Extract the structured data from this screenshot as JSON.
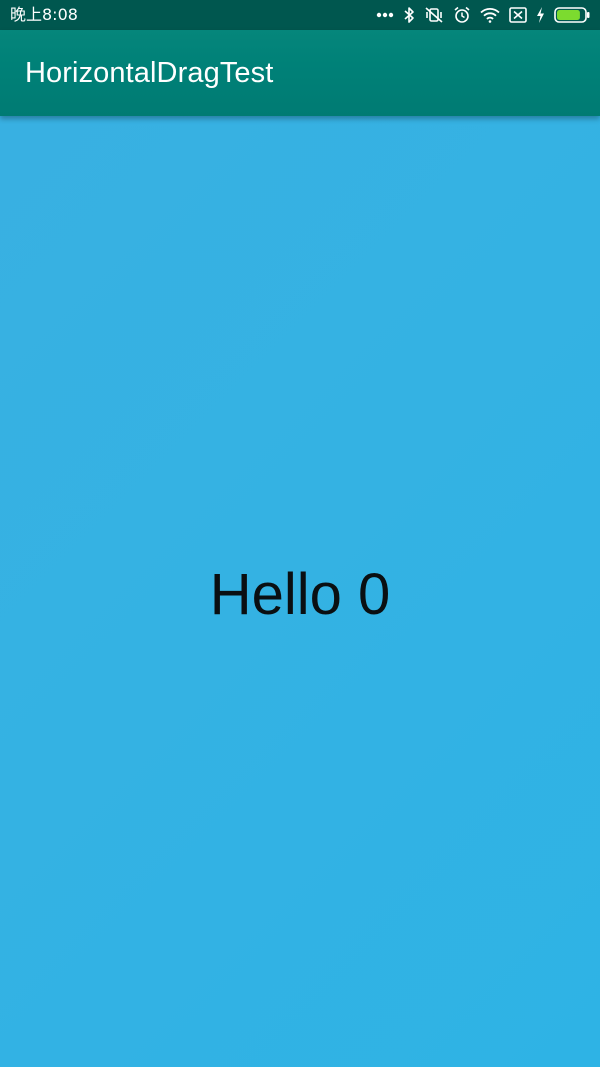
{
  "status_bar": {
    "time": "晚上8:08",
    "icons": [
      "more-dots-icon",
      "bluetooth-icon",
      "vibrate-off-icon",
      "alarm-icon",
      "wifi-icon",
      "sim-blocked-icon",
      "charging-bolt-icon",
      "battery-icon"
    ],
    "battery_level": 0.85,
    "battery_color": "#7CDB2F"
  },
  "app_bar": {
    "title": "HorizontalDragTest",
    "color": "#00857A"
  },
  "main": {
    "message": "Hello 0",
    "background": "#36B2E4"
  }
}
